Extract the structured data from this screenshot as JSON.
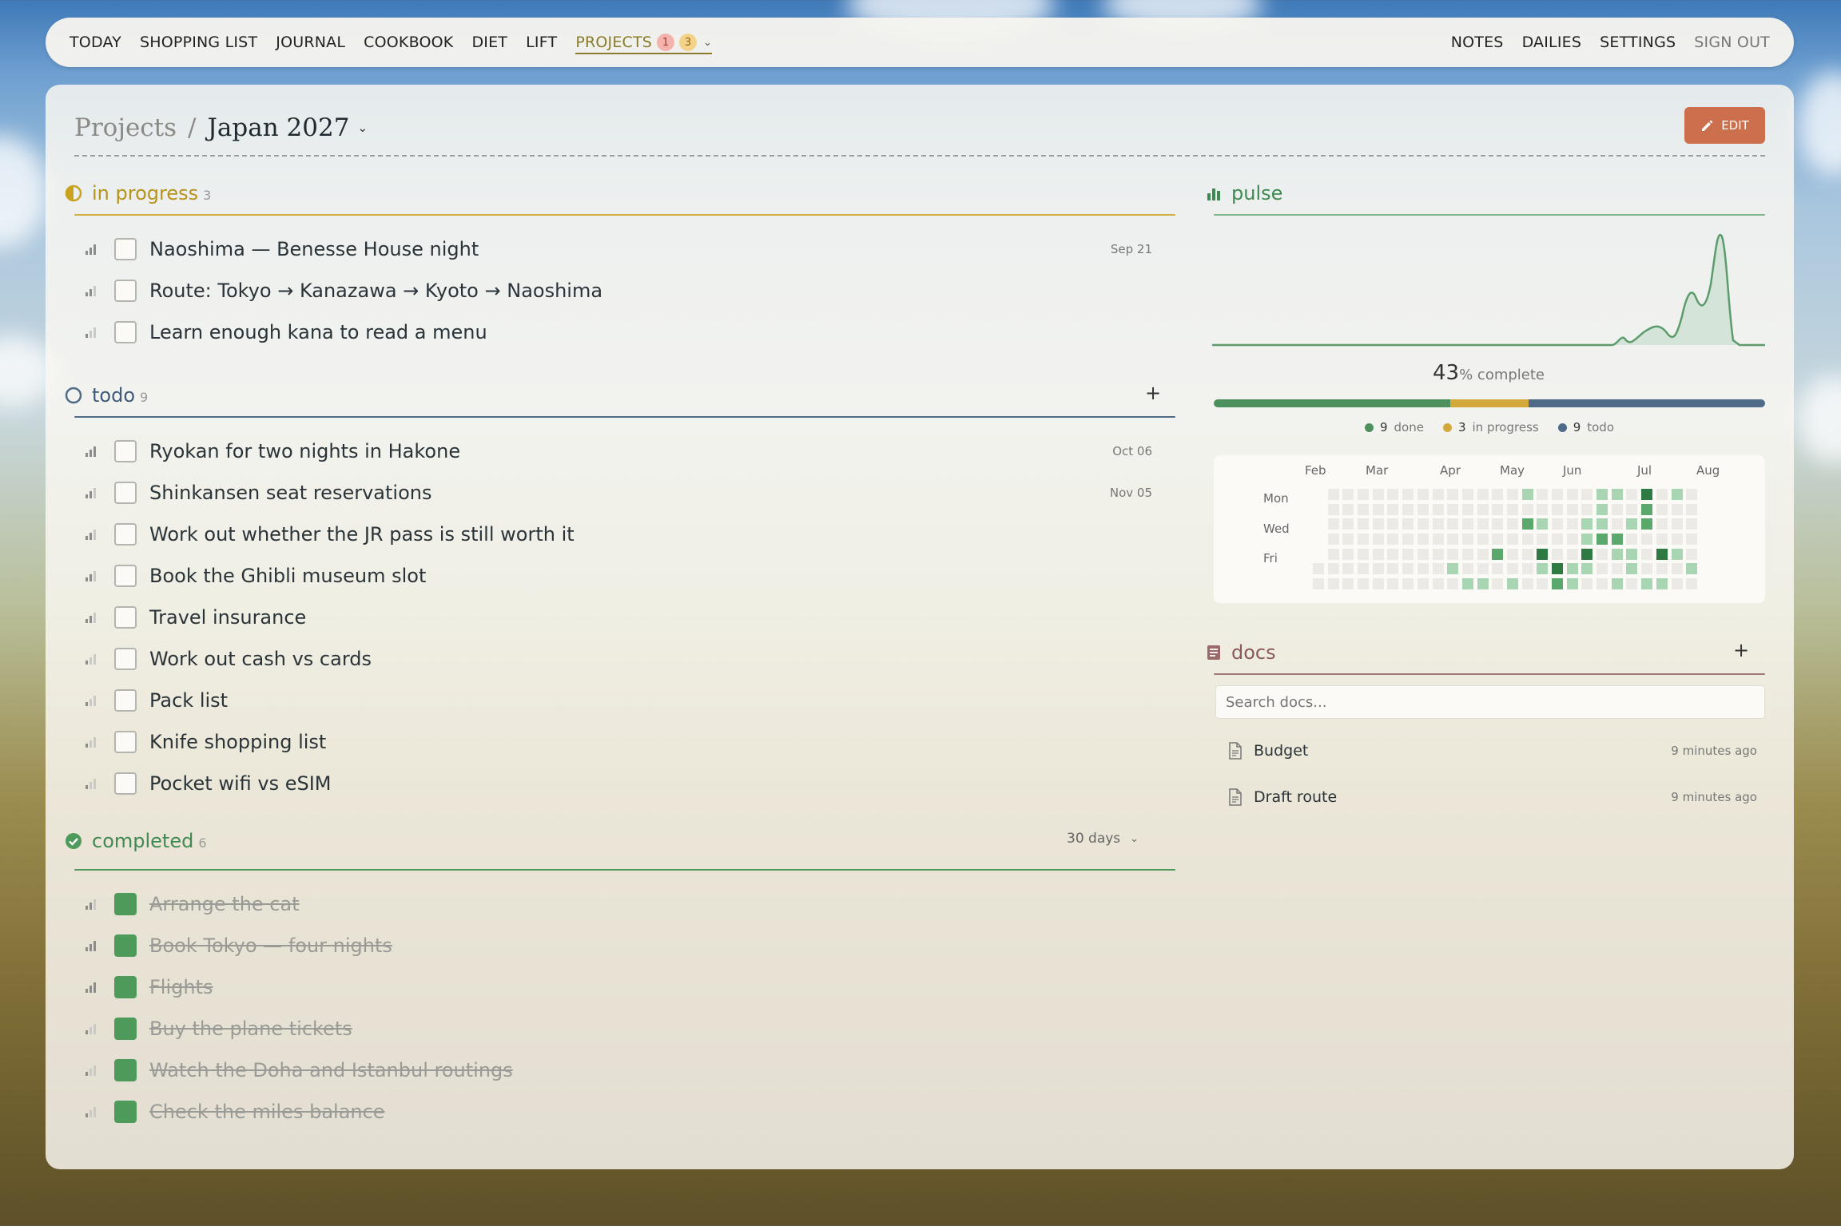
{
  "nav": {
    "left": [
      "TODAY",
      "SHOPPING LIST",
      "JOURNAL",
      "COOKBOOK",
      "DIET",
      "LIFT"
    ],
    "projects": {
      "label": "PROJECTS",
      "badge_red": "1",
      "badge_yellow": "3"
    },
    "right": [
      "NOTES",
      "DAILIES",
      "SETTINGS",
      "SIGN OUT"
    ]
  },
  "header": {
    "crumb_root": "Projects",
    "crumb_sep": "/",
    "crumb_current": "Japan 2027",
    "edit_label": "EDIT"
  },
  "in_progress": {
    "title": "in progress",
    "count": "3",
    "tasks": [
      {
        "label": "Naoshima — Benesse House night",
        "due": "Sep 21"
      },
      {
        "label": "Route: Tokyo → Kanazawa → Kyoto → Naoshima",
        "due": ""
      },
      {
        "label": "Learn enough kana to read a menu",
        "due": ""
      }
    ]
  },
  "todo": {
    "title": "todo",
    "count": "9",
    "add": "+",
    "tasks": [
      {
        "label": "Ryokan for two nights in Hakone",
        "due": "Oct 06"
      },
      {
        "label": "Shinkansen seat reservations",
        "due": "Nov 05"
      },
      {
        "label": "Work out whether the JR pass is still worth it",
        "due": ""
      },
      {
        "label": "Book the Ghibli museum slot",
        "due": ""
      },
      {
        "label": "Travel insurance",
        "due": ""
      },
      {
        "label": "Work out cash vs cards",
        "due": ""
      },
      {
        "label": "Pack list",
        "due": ""
      },
      {
        "label": "Knife shopping list",
        "due": ""
      },
      {
        "label": "Pocket wifi vs eSIM",
        "due": ""
      }
    ]
  },
  "completed": {
    "title": "completed",
    "count": "6",
    "filter": "30 days",
    "tasks": [
      {
        "label": "Arrange the cat"
      },
      {
        "label": "Book Tokyo — four nights"
      },
      {
        "label": "Flights"
      },
      {
        "label": "Buy the plane tickets"
      },
      {
        "label": "Watch the Doha and Istanbul routings"
      },
      {
        "label": "Check the miles balance"
      }
    ]
  },
  "pulse": {
    "title": "pulse",
    "percent": "43",
    "percent_suffix": "% complete",
    "done": 9,
    "in_progress": 3,
    "todo": 9,
    "done_label": "done",
    "in_progress_label": "in progress",
    "todo_label": "todo",
    "colors": {
      "done": "#4e8f5e",
      "in_progress": "#d2a93a",
      "todo": "#4f6b88",
      "accent_in_progress": "#c9a21e",
      "accent_todo": "#3e5a78",
      "accent_done": "#3f8a52",
      "edit": "#cc6f4c"
    },
    "heatmap_months": [
      "Feb",
      "Mar",
      "Apr",
      "May",
      "Jun",
      "Jul",
      "Aug"
    ],
    "heatmap_days": [
      "Mon",
      "Wed",
      "Fri"
    ]
  },
  "docs": {
    "title": "docs",
    "add": "+",
    "search_placeholder": "Search docs...",
    "items": [
      {
        "name": "Budget",
        "time": "9 minutes ago"
      },
      {
        "name": "Draft route",
        "time": "9 minutes ago"
      }
    ]
  }
}
